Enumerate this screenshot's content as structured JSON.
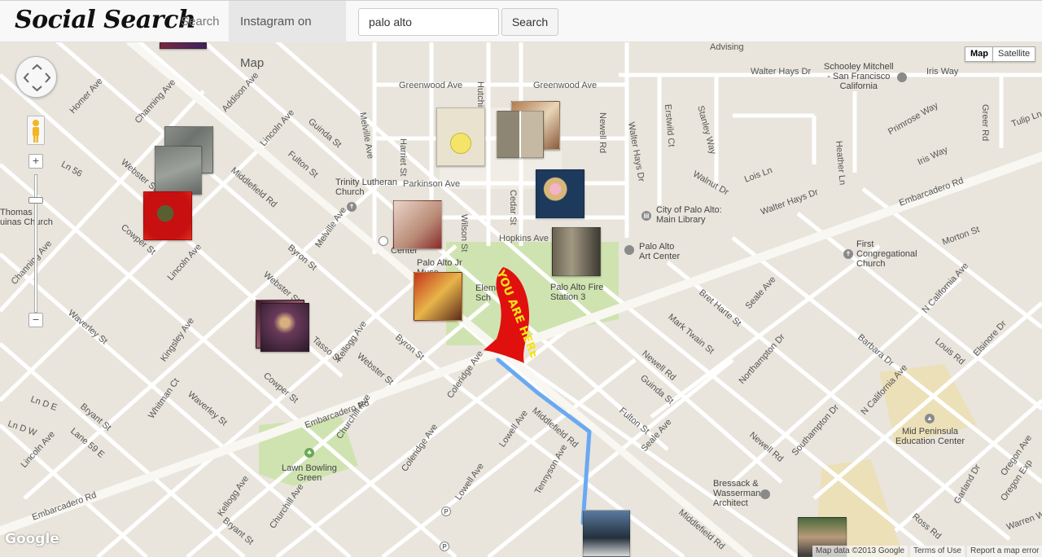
{
  "header": {
    "brand": "Social Search",
    "nav": [
      {
        "label": "Search",
        "active": false
      },
      {
        "label": "Instagram on Map",
        "active": true
      }
    ],
    "search": {
      "value": "palo alto",
      "placeholder": ""
    },
    "search_button": "Search"
  },
  "map": {
    "type_controls": [
      {
        "label": "Map",
        "active": true
      },
      {
        "label": "Satellite",
        "active": false
      }
    ],
    "callout": "YOU ARE HERE",
    "route_color": "#6aa9f2",
    "accent_red": "#e0100e",
    "road_labels": [
      "Middlefield Rd",
      "Middlefield Rd",
      "Middlefield Rd",
      "Embarcadero Rd",
      "Embarcadero Rd",
      "Embarcadero Rd",
      "Lincoln Ave",
      "Lincoln Ave",
      "Lincoln Ave",
      "Addison Ave",
      "Channing Ave",
      "Channing Ave",
      "Homer Ave",
      "Webster St",
      "Webster St",
      "Webster St",
      "Guinda St",
      "Guinda St",
      "Fulton St",
      "Fulton St",
      "Byron St",
      "Byron St",
      "Melville Ave",
      "Melville Ave",
      "Greenwood Ave",
      "Greenwood Ave",
      "Parkinson Ave",
      "Hopkins Ave",
      "Harriet St",
      "Wilson St",
      "Cedar St",
      "Hutchinson Ave",
      "Newell Rd",
      "Newell Rd",
      "Newell Rd",
      "Walter Hays Dr",
      "Walter Hays Dr",
      "Walter Hays Dr",
      "Erstwild Ct",
      "Stanley Way",
      "Heather Ln",
      "Primrose Way",
      "Iris Way",
      "Iris Way",
      "Tulip Ln",
      "Greer Rd",
      "Walnut Dr",
      "Lois Ln",
      "Morton St",
      "Seale Ave",
      "Seale Ave",
      "Bret Harte St",
      "Mark Twain St",
      "Northampton Dr",
      "Southampton Dr",
      "N California Ave",
      "N California Ave",
      "Louis Rd",
      "Elsinore Dr",
      "Barbara Dr",
      "Garland Dr",
      "Oregon Ave",
      "Ross Rd",
      "Tennyson Ave",
      "Lowell Ave",
      "Lowell Ave",
      "Coleridge Ave",
      "Coleridge Ave",
      "Kellogg Ave",
      "Kellogg Ave",
      "Tasso St",
      "Cowper St",
      "Cowper St",
      "Waverley St",
      "Waverley St",
      "Kingsley Ave",
      "Bryant St",
      "Bryant St",
      "Churchill Ave",
      "Churchill Ave",
      "Whitman Ct",
      "Lane 59 E",
      "Ln D E",
      "Ln D W",
      "Ln 56",
      "Warren Wa",
      "Oregon Exp",
      "Advising"
    ],
    "pois": [
      {
        "label": "Trinity Lutheran\nChurch"
      },
      {
        "label": "City of Palo Alto:\nMain Library"
      },
      {
        "label": "Palo Alto\nArt Center"
      },
      {
        "label": "Palo Alto Fire\nStation 3"
      },
      {
        "label": "Palo Alto Jr\nMuse"
      },
      {
        "label": "Eleme\nSch"
      },
      {
        "label": "Schooley Mitchell\n- San Francisco\nCalifornia"
      },
      {
        "label": "First\nCongregational\nChurch"
      },
      {
        "label": "Mid Peninsula\nEducation Center"
      },
      {
        "label": "Bressack &\nWasserman\nArchitect"
      },
      {
        "label": "Lawn Bowling\nGreen"
      },
      {
        "label": "Thomas\nuinas Church"
      },
      {
        "label": "Center"
      }
    ],
    "attribution": {
      "data": "Map data ©2013 Google",
      "terms": "Terms of Use",
      "report": "Report a map error",
      "logo": "Google"
    }
  }
}
